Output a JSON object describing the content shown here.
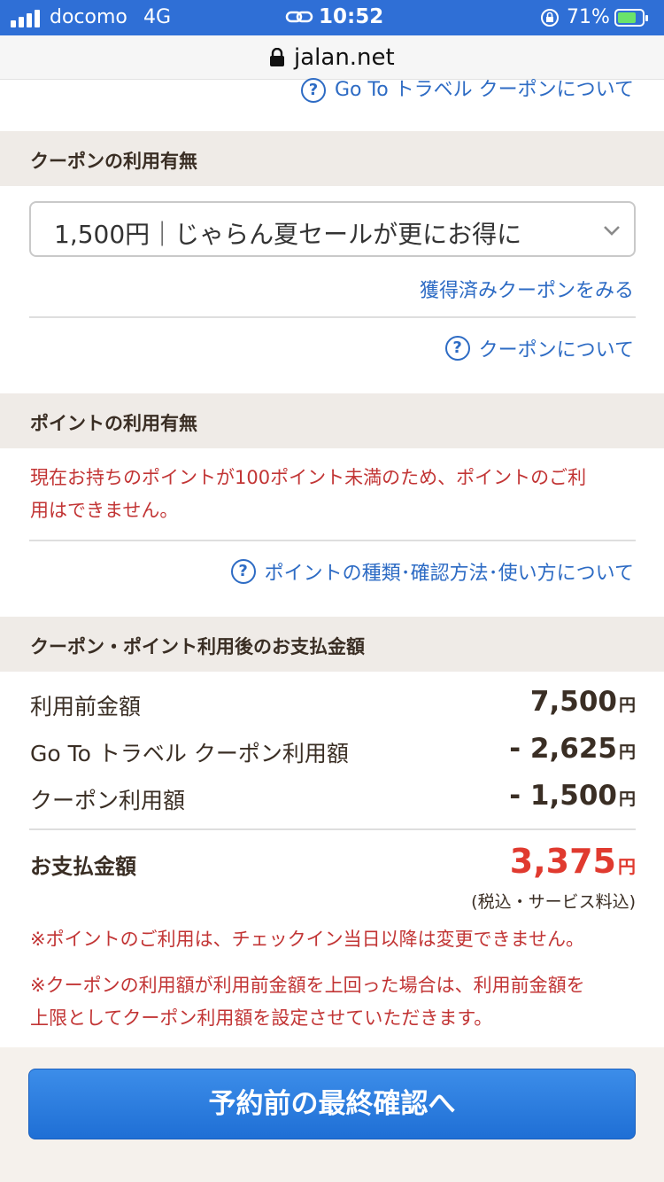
{
  "status_bar": {
    "carrier": "docomo",
    "network": "4G",
    "time": "10:52",
    "battery_percent": "71%"
  },
  "url_bar": {
    "domain": "jalan.net"
  },
  "goto_coupon_link": "Go To トラベル クーポンについて",
  "coupon_section": {
    "title": "クーポンの利用有無",
    "selected_coupon": "1,500円｜じゃらん夏セールが更にお得に",
    "acquired_link": "獲得済みクーポンをみる",
    "about_link": "クーポンについて"
  },
  "point_section": {
    "title": "ポイントの利用有無",
    "notice_line1": "現在お持ちのポイントが100ポイント未満のため、ポイントのご利",
    "notice_line2": "用はできません。",
    "help_link": "ポイントの種類･確認方法･使い方について"
  },
  "payment_section": {
    "title": "クーポン・ポイント利用後のお支払金額",
    "rows": [
      {
        "label": "利用前金額",
        "amount": "7,500",
        "unit": "円"
      },
      {
        "label": "Go To トラベル クーポン利用額",
        "amount": "- 2,625",
        "unit": "円"
      },
      {
        "label": "クーポン利用額",
        "amount": "- 1,500",
        "unit": "円"
      }
    ],
    "total_label": "お支払金額",
    "total_amount": "3,375",
    "total_unit": "円",
    "tax_note": "(税込・サービス料込)",
    "warning1": "※ポイントのご利用は、チェックイン当日以降は変更できません。",
    "warning2_line1": "※クーポンの利用額が利用前金額を上回った場合は、利用前金額を",
    "warning2_line2": "上限としてクーポン利用額を設定させていただきます。"
  },
  "cta": {
    "label": "予約前の最終確認へ"
  },
  "colors": {
    "status_bar": "#2f6fd6",
    "link_blue": "#2d6bc4",
    "notice_red": "#c23535",
    "total_red": "#e03a2f",
    "section_header_bg": "#efebe7",
    "cta_blue": "#1f6fd5"
  }
}
